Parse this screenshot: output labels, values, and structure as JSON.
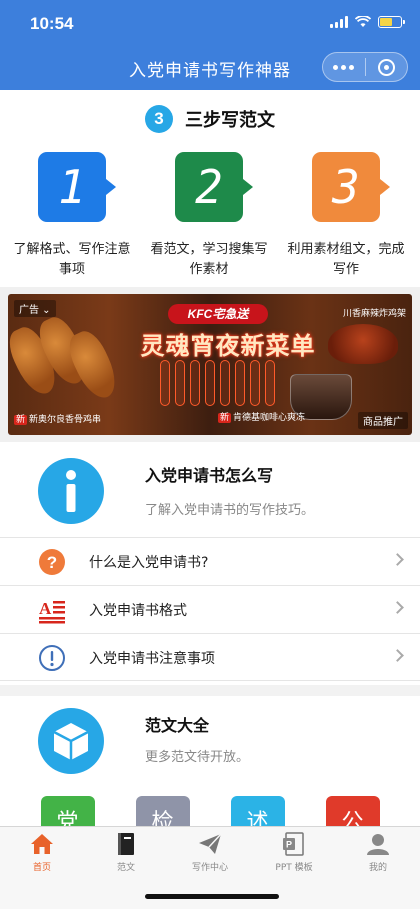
{
  "status_bar": {
    "time": "10:54"
  },
  "nav": {
    "title": "入党申请书写作神器"
  },
  "steps": {
    "number": "3",
    "title": "三步写范文",
    "items": [
      {
        "num": "1",
        "color": "#1e7be6",
        "text": "了解格式、写作注意事项"
      },
      {
        "num": "2",
        "color": "#1e8a4a",
        "text": "看范文，学习搜集写作素材"
      },
      {
        "num": "3",
        "color": "#f08a3c",
        "text": "利用素材组文，完成写作"
      }
    ]
  },
  "ad": {
    "tag": "广告",
    "brand": "KFC宅急送",
    "headline": "灵魂宵夜新菜单",
    "top_right": "川香麻辣炸鸡架",
    "caption_left": "新奥尔良香骨鸡串",
    "caption_right": "肯德基咖啡心爽冻",
    "new_badge": "新",
    "promo": "商品推广"
  },
  "howto": {
    "title": "入党申请书怎么写",
    "subtitle": "了解入党申请书的写作技巧。",
    "items": [
      {
        "label": "什么是入党申请书?",
        "icon": "question-icon"
      },
      {
        "label": "入党申请书格式",
        "icon": "format-icon"
      },
      {
        "label": "入党申请书注意事项",
        "icon": "alert-icon"
      }
    ]
  },
  "samples": {
    "title": "范文大全",
    "subtitle": "更多范文待开放。",
    "tiles": [
      {
        "label": "党",
        "color": "#43b347"
      },
      {
        "label": "检",
        "color": "#8f94a8"
      },
      {
        "label": "述",
        "color": "#2bb3e6"
      },
      {
        "label": "公",
        "color": "#e03a2a"
      }
    ]
  },
  "tabbar": {
    "tabs": [
      {
        "label": "首页",
        "icon": "home-icon",
        "active": true
      },
      {
        "label": "范文",
        "icon": "book-icon",
        "active": false
      },
      {
        "label": "写作中心",
        "icon": "send-icon",
        "active": false
      },
      {
        "label": "PPT 模板",
        "icon": "ppt-icon",
        "active": false
      },
      {
        "label": "我的",
        "icon": "user-icon",
        "active": false
      }
    ]
  },
  "colors": {
    "primary": "#3d7fdc",
    "accent": "#e8622a",
    "info": "#27a7e6"
  }
}
